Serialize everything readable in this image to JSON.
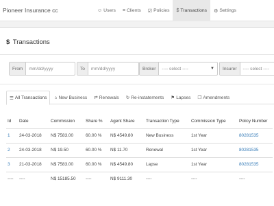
{
  "brand": "Pioneer Insurance cc",
  "nav": [
    {
      "icon": "user-icon",
      "glyph": "☺",
      "label": "Users"
    },
    {
      "icon": "list-icon",
      "glyph": "≡",
      "label": "Clients"
    },
    {
      "icon": "policies-icon",
      "glyph": "☑",
      "label": "Policies"
    },
    {
      "icon": "dollar-icon",
      "glyph": "$",
      "label": "Transactions",
      "active": true
    },
    {
      "icon": "gear-icon",
      "glyph": "⚙",
      "label": "Settings"
    }
  ],
  "panel": {
    "title_icon": "$",
    "title": "Transactions"
  },
  "filters": {
    "from_label": "From",
    "from_placeholder": "mm/dd/yyyy",
    "to_label": "To",
    "to_placeholder": "mm/dd/yyyy",
    "broker_label": "Broker",
    "broker_value": "---- select ----",
    "insurer_label": "Insurer",
    "insurer_value": "---- select ----"
  },
  "tabs": [
    {
      "icon": "list-icon",
      "glyph": "☰",
      "label": "All Transactions",
      "active": true
    },
    {
      "icon": "building-icon",
      "glyph": "⌂",
      "label": "New Business"
    },
    {
      "icon": "renew-icon",
      "glyph": "⇄",
      "label": "Renewals"
    },
    {
      "icon": "refresh-icon",
      "glyph": "↻",
      "label": "Re-instatements"
    },
    {
      "icon": "flag-icon",
      "glyph": "⚑",
      "label": "Lapses"
    },
    {
      "icon": "copy-icon",
      "glyph": "❐",
      "label": "Amendments"
    }
  ],
  "table": {
    "headers": [
      "Id",
      "Date",
      "Commission",
      "Share %",
      "Agent Share",
      "Transaction Type",
      "Commission Type",
      "Policy Number"
    ],
    "rows": [
      [
        "1",
        "24-03-2018",
        "N$ 7583.00",
        "60.00 %",
        "N$ 4549.80",
        "New Business",
        "1st Year",
        "80281535"
      ],
      [
        "2",
        "24-03-2018",
        "N$ 19.50",
        "60.00 %",
        "N$ 11.70",
        "Renewal",
        "1st Year",
        "80281535"
      ],
      [
        "3",
        "21-03-2018",
        "N$ 7583.00",
        "60.00 %",
        "N$ 4549.80",
        "Lapse",
        "1st Year",
        "80281535"
      ]
    ],
    "totals": [
      "----",
      "----",
      "N$ 15185.50",
      "----",
      "N$ 9111.30",
      "----",
      "----",
      "----"
    ]
  }
}
